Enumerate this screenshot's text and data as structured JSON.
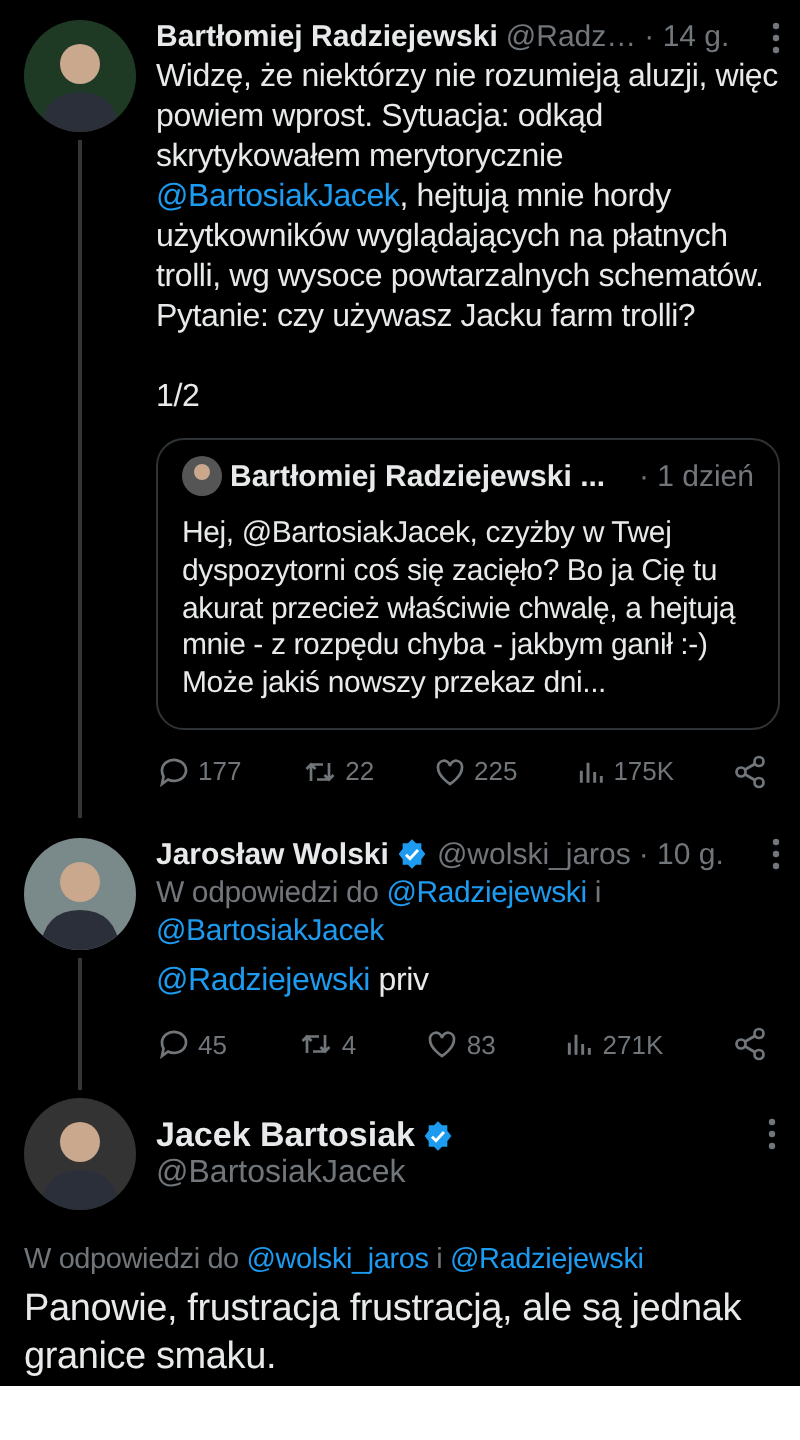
{
  "tweets": [
    {
      "name": "Bartłomiej Radziejewski",
      "verified": false,
      "handle": "@Radz…",
      "time": "· 14 g.",
      "thread_line": true,
      "text": [
        {
          "kind": "plain",
          "text": "Widzę, że niektórzy nie rozumieją aluzji, więc powiem wprost. Sytuacja: odkąd skrytykowałem merytorycznie "
        },
        {
          "kind": "link",
          "text": "@BartosiakJacek"
        },
        {
          "kind": "plain",
          "text": ", hejtują mnie hordy użytkowników wyglądających na płatnych trolli, wg wysoce powtarzalnych schematów. Pytanie: czy używasz Jacku farm trolli?"
        }
      ],
      "footnote": "1/2",
      "quote": {
        "name": "Bartłomiej Radziejewski ...",
        "time": "· 1 dzień",
        "text": [
          {
            "kind": "plain",
            "text": "Hej, @BartosiakJacek, czyżby w Twej dyspozytorni coś się zacięło? Bo ja Cię tu akurat przecież właściwie chwalę, a hejtują mnie - z rozpędu chyba - jakbym ganił :-) Może jakiś nowszy przekaz dni..."
          }
        ]
      },
      "stats": {
        "replies": "177",
        "reposts": "22",
        "likes": "225",
        "views": "175K"
      }
    },
    {
      "name": "Jarosław Wolski",
      "verified": true,
      "handle": "@wolski_jaros",
      "time": "· 10 g.",
      "thread_line": true,
      "reply_to": [
        {
          "kind": "plain",
          "text": "W odpowiedzi do "
        },
        {
          "kind": "link",
          "text": "@Radziejewski"
        },
        {
          "kind": "plain",
          "text": " i "
        },
        {
          "kind": "link",
          "text": "@BartosiakJacek"
        }
      ],
      "text": [
        {
          "kind": "link",
          "text": "@Radziejewski"
        },
        {
          "kind": "plain",
          "text": " priv"
        }
      ],
      "stats": {
        "replies": "45",
        "reposts": "4",
        "likes": "83",
        "views": "271K"
      }
    }
  ],
  "main_tweet": {
    "name": "Jacek Bartosiak",
    "verified": true,
    "handle": "@BartosiakJacek",
    "reply_to": [
      {
        "kind": "plain",
        "text": "W odpowiedzi do "
      },
      {
        "kind": "link",
        "text": "@wolski_jaros"
      },
      {
        "kind": "plain",
        "text": " i "
      },
      {
        "kind": "link",
        "text": "@Radziejewski"
      }
    ],
    "text": "Panowie, frustracja frustracją, ale są jednak granice smaku."
  }
}
